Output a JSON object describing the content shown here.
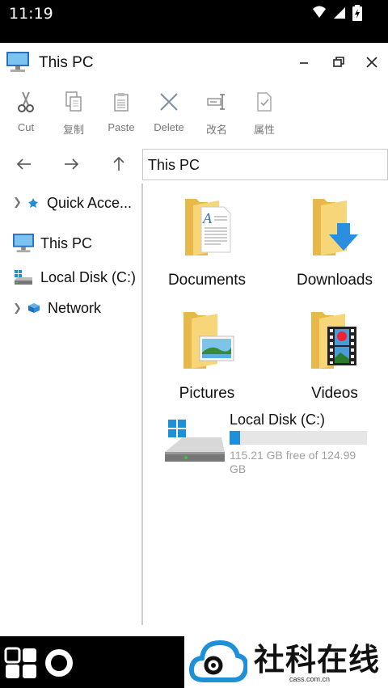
{
  "status_bar": {
    "time": "11:19",
    "icons": [
      "wifi-icon",
      "signal-icon",
      "battery-charging-icon"
    ]
  },
  "window": {
    "title": "This PC"
  },
  "toolbar": {
    "cut": "Cut",
    "copy": "复制",
    "paste": "Paste",
    "delete": "Delete",
    "rename": "改名",
    "properties": "属性"
  },
  "nav": {
    "address": "This PC"
  },
  "sidebar": {
    "quick_access": "Quick Acce...",
    "this_pc": "This PC",
    "local_disk": "Local Disk (C:)",
    "network": "Network"
  },
  "content": {
    "folders": {
      "documents": "Documents",
      "downloads": "Downloads",
      "pictures": "Pictures",
      "videos": "Videos"
    },
    "disk": {
      "label": "Local Disk (C:)",
      "free_text": "115.21 GB free of 124.99 GB",
      "used_fraction": 0.078
    }
  },
  "watermark": {
    "text": "社科在线",
    "sub": "cass.com.cn"
  },
  "colors": {
    "accent": "#1e90d8",
    "folder": "#f5cf6b"
  }
}
